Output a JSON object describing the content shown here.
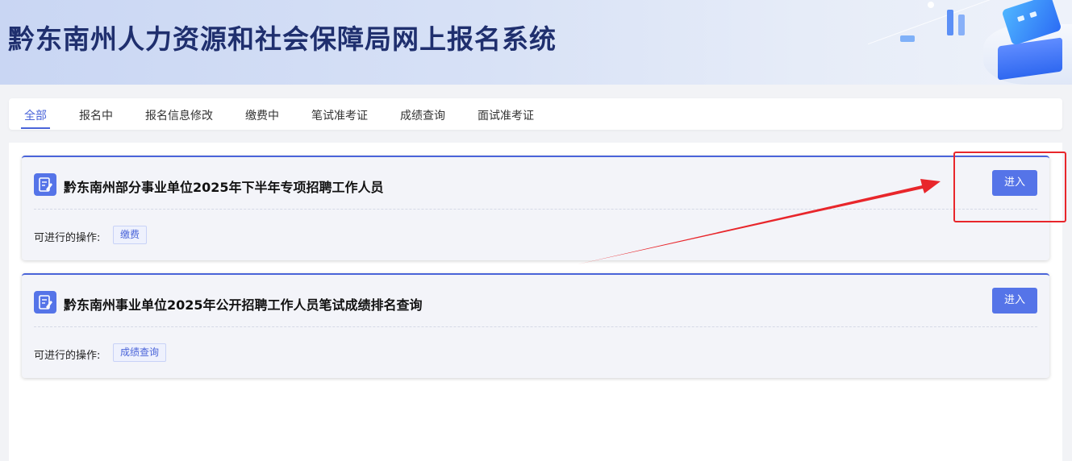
{
  "header": {
    "title": "黔东南州人力资源和社会保障局网上报名系统"
  },
  "tabs": [
    {
      "label": "全部",
      "active": true
    },
    {
      "label": "报名中",
      "active": false
    },
    {
      "label": "报名信息修改",
      "active": false
    },
    {
      "label": "缴费中",
      "active": false
    },
    {
      "label": "笔试准考证",
      "active": false
    },
    {
      "label": "成绩查询",
      "active": false
    },
    {
      "label": "面试准考证",
      "active": false
    }
  ],
  "cards": [
    {
      "title": "黔东南州部分事业单位2025年下半年专项招聘工作人员",
      "enter_label": "进入",
      "ops_label": "可进行的操作:",
      "ops": [
        "缴费"
      ]
    },
    {
      "title": "黔东南州事业单位2025年公开招聘工作人员笔试成绩排名查询",
      "enter_label": "进入",
      "ops_label": "可进行的操作:",
      "ops": [
        "成绩查询"
      ]
    }
  ],
  "colors": {
    "accent": "#4a64d9",
    "button": "#5574e8",
    "annotation": "#e8262b"
  },
  "icons": {
    "card_icon": "edit-document-icon"
  }
}
